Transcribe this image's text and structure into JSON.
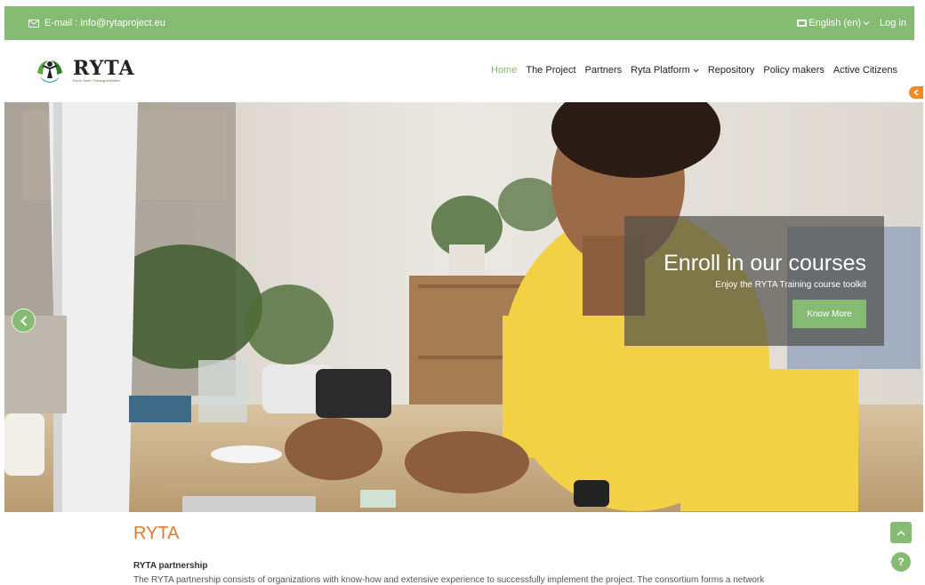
{
  "topbar": {
    "email": "E-mail : info@rytaproject.eu",
    "language": "English (en)",
    "login": "Log in"
  },
  "brand": {
    "name": "RYTA",
    "tagline": "Rural Youth Training Activities"
  },
  "nav": {
    "items": [
      {
        "label": "Home"
      },
      {
        "label": "The Project"
      },
      {
        "label": "Partners"
      },
      {
        "label": "Ryta Platform"
      },
      {
        "label": "Repository"
      },
      {
        "label": "Policy makers"
      },
      {
        "label": "Active Citizens"
      }
    ],
    "active": "Home"
  },
  "hero": {
    "title": "Enroll in our courses",
    "subtitle": "Enjoy the RYTA Training course toolkit",
    "button": "Know More"
  },
  "content": {
    "title": "RYTA",
    "subtitle": "RYTA partnership",
    "text": "The RYTA partnership consists of organizations with know-how and extensive experience to successfully implement the project. The consortium forms a network"
  },
  "help": "?",
  "colors": {
    "brand_green": "#86bb73",
    "accent_orange": "#e8782a"
  },
  "icons": [
    "mail-icon",
    "flag-icon",
    "chevron-down-icon",
    "chevron-left-icon",
    "chevron-up-icon",
    "help-icon"
  ]
}
